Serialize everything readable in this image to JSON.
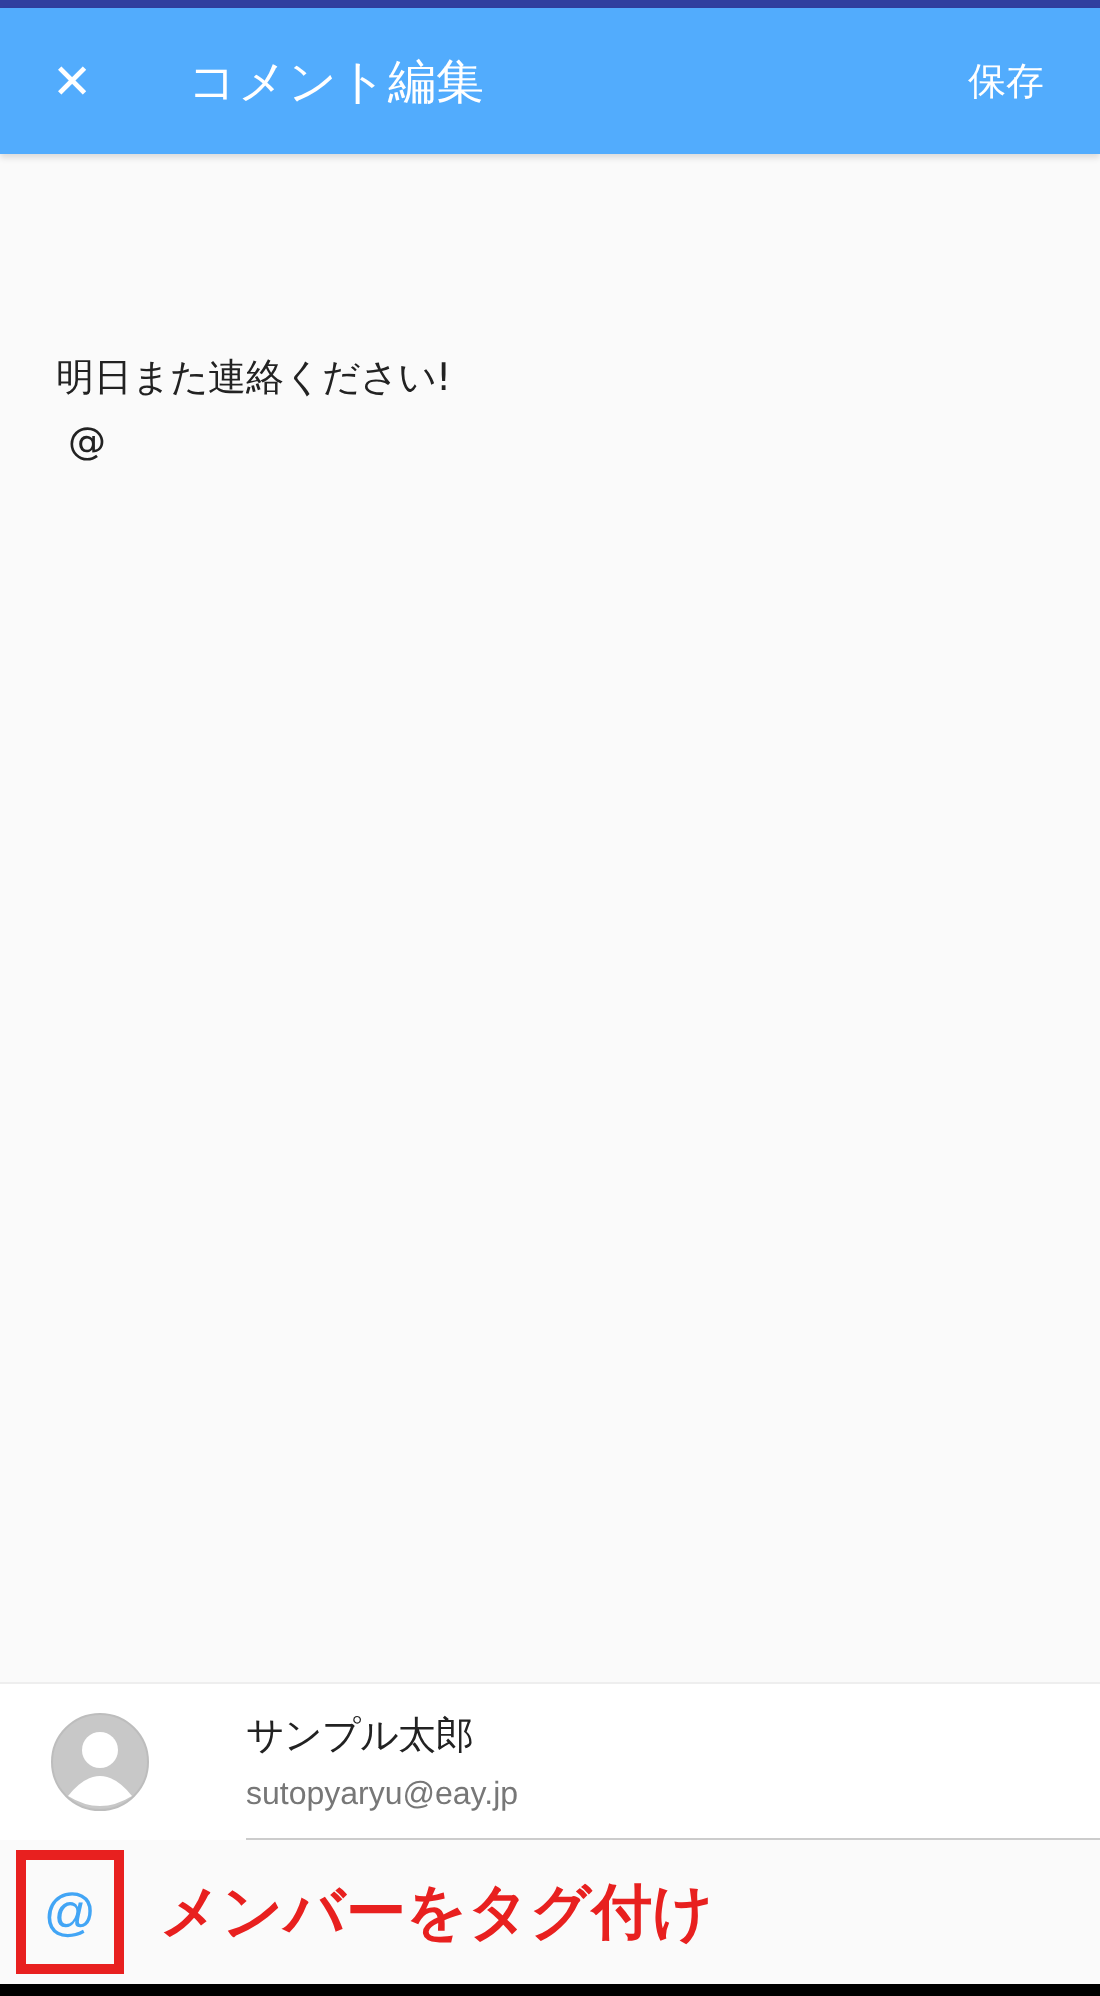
{
  "app_bar": {
    "close": "✕",
    "title": "コメント編集",
    "save": "保存"
  },
  "comment": {
    "lines": [
      "明日また連絡ください!",
      "@"
    ]
  },
  "mention_suggestions": [
    {
      "name": "サンプル太郎",
      "email": "sutopyaryu@eay.jp"
    }
  ],
  "toolbar": {
    "mention_button": "@"
  },
  "annotation": {
    "label": "メンバーをタグ付け",
    "color": "#e8201f"
  }
}
